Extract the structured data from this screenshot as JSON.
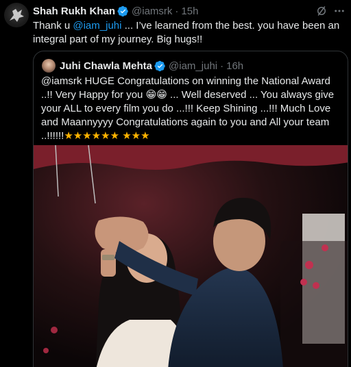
{
  "tweet": {
    "author_name": "Shah Rukh Khan",
    "author_handle": "@iamsrk",
    "separator": "·",
    "time": "15h",
    "text_before": "Thank u ",
    "mention": "@iam_juhi",
    "text_after": " ... I’ve learned from the best. you have been an integral part of my journey. Big hugs!!"
  },
  "quote": {
    "author_name": "Juhi Chawla Mehta",
    "author_handle": "@iam_juhi",
    "separator": "·",
    "time": "16h",
    "text_1": "@iamsrk HUGE Congratulations on winning the National Award ..!! Very Happy for you ",
    "emoji_grin": "😁😁",
    "text_2": " ... Well deserved ... You always give your ALL to every film you do ...!!! Keep Shining ...!!! Much Love and Maannyyyy Congratulations again to you and All your team ..!!!!!!",
    "stars_line1": "★★★★★★",
    "stars_line2": "★★★"
  },
  "icons": {
    "verified": "verified-badge-icon",
    "grok": "grok-icon",
    "more": "more-icon"
  },
  "colors": {
    "background": "#000000",
    "text": "#e7e9ea",
    "muted": "#71767b",
    "accent": "#1d9bf0",
    "border": "#2f3336"
  }
}
